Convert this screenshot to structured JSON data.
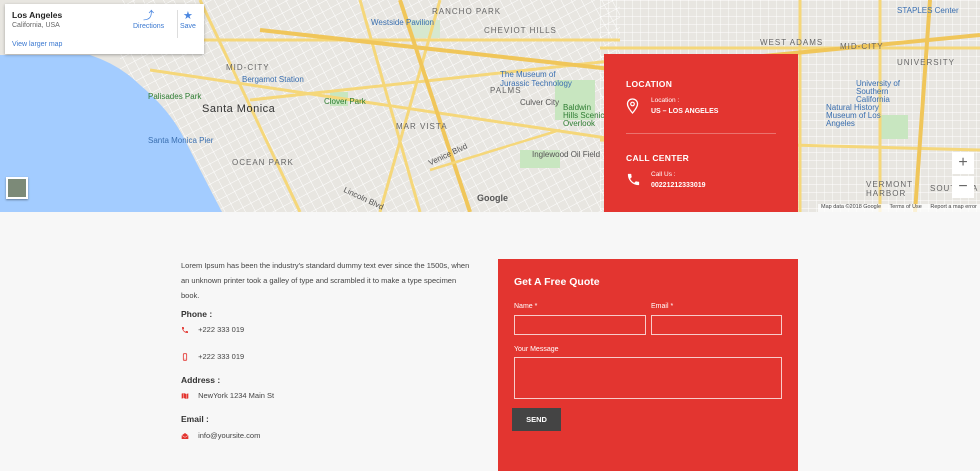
{
  "map": {
    "info_card": {
      "place": "Los Angeles",
      "sub": "California, USA",
      "directions_label": "Directions",
      "save_label": "Save",
      "larger_map_label": "View larger map"
    },
    "zoom_in": "+",
    "zoom_out": "−",
    "google_logo": "Google",
    "attribution": {
      "data": "Map data ©2018 Google",
      "terms": "Terms of Use",
      "report": "Report a map error"
    },
    "labels": {
      "westwood": "Westside Pavilion",
      "rancho": "RANCHO PARK",
      "cheviot": "CHEVIOT HILLS",
      "midcity_w": "MID-CITY",
      "midcity_e": "MID-CITY",
      "bergamot": "Bergamot Station",
      "palisades": "Palisades Park",
      "santa_monica": "Santa Monica",
      "clover": "Clover Park",
      "mar_vista": "MAR VISTA",
      "palms": "PALMS",
      "museum": "The Museum of Jurassic Technology",
      "culver": "Culver City",
      "baldwin": "Baldwin Hills Scenic Overlook",
      "pier": "Santa Monica Pier",
      "ocean_park": "OCEAN PARK",
      "venice_blvd": "Venice Blvd",
      "inglewood": "Inglewood Oil Field",
      "lincoln": "Lincoln Blvd",
      "staples": "STAPLES Center",
      "university": "UNIVERSITY",
      "usc": "University of Southern California",
      "nhm": "Natural History Museum of Los Angeles",
      "vermont": "VERMONT HARBOR",
      "south": "SOUTH PA",
      "west_adams": "WEST ADAMS"
    }
  },
  "location_panel": {
    "location_heading": "LOCATION",
    "location_label": "Location :",
    "location_value": "US – LOS ANGELES",
    "call_heading": "CALL CENTER",
    "call_label": "Call Us :",
    "call_value": "00221212333019"
  },
  "contact": {
    "intro": "Lorem Ipsum has been the industry's standard dummy text ever since the 1500s, when an unknown printer took a galley of type and scrambled it to make a type specimen book.",
    "phone_heading": "Phone :",
    "phone1": "+222 333 019",
    "phone2": "+222 333 019",
    "address_heading": "Address :",
    "address": "NewYork 1234 Main St",
    "email_heading": "Email :",
    "email": "info@yoursite.com"
  },
  "quote_form": {
    "title": "Get A Free Quote",
    "name_label": "Name *",
    "email_label": "Email *",
    "message_label": "Your Message",
    "send_label": "SEND"
  },
  "colors": {
    "accent": "#e33530",
    "send_button": "#444444",
    "water": "#a3ccff"
  }
}
